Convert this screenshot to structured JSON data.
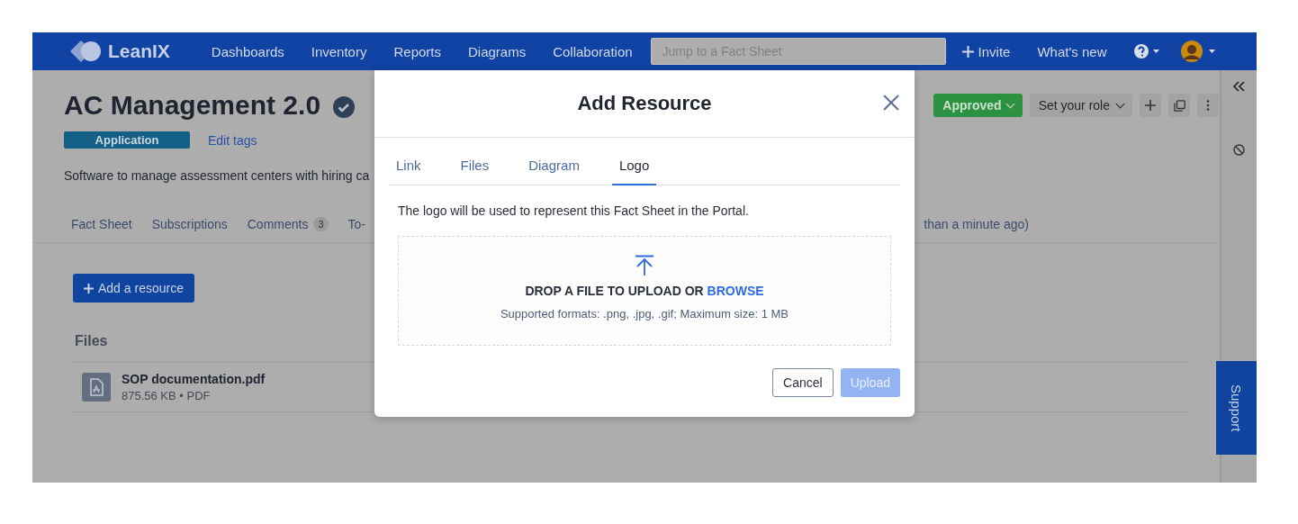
{
  "nav": {
    "logo": "LeanIX",
    "items": [
      "Dashboards",
      "Inventory",
      "Reports",
      "Diagrams",
      "Collaboration"
    ],
    "search": {
      "placeholder": "Jump to a Fact Sheet"
    },
    "invite": "Invite",
    "whats_new": "What's new"
  },
  "fact_sheet": {
    "title": "AC Management 2.0",
    "tag": "Application",
    "edit_tags": "Edit tags",
    "description": "Software to manage assessment centers with hiring ca",
    "status": "Approved",
    "role": "Set your role",
    "tabs": [
      {
        "label": "Fact Sheet"
      },
      {
        "label": "Subscriptions"
      },
      {
        "label": "Comments",
        "count": "3"
      },
      {
        "label": "To-"
      }
    ],
    "updated": "than a minute ago)"
  },
  "resources": {
    "add_button": "Add a resource",
    "section": "Files",
    "files": [
      {
        "name": "SOP documentation.pdf",
        "meta": "875.56 KB • PDF"
      }
    ]
  },
  "support": "Support",
  "modal": {
    "title": "Add Resource",
    "tabs": [
      {
        "label": "Link",
        "selected": false
      },
      {
        "label": "Files",
        "selected": false
      },
      {
        "label": "Diagram",
        "selected": false
      },
      {
        "label": "Logo",
        "selected": true
      }
    ],
    "description": "The logo will be used to represent this Fact Sheet in the Portal.",
    "dropzone": {
      "text": "DROP A FILE TO UPLOAD OR",
      "link": "BROWSE",
      "hint": "Supported formats: .png, .jpg, .gif; Maximum size: 1 MB"
    },
    "buttons": [
      {
        "label": "Cancel",
        "kind": "secondary",
        "disabled": false
      },
      {
        "label": "Upload",
        "kind": "primary",
        "disabled": true
      }
    ]
  }
}
